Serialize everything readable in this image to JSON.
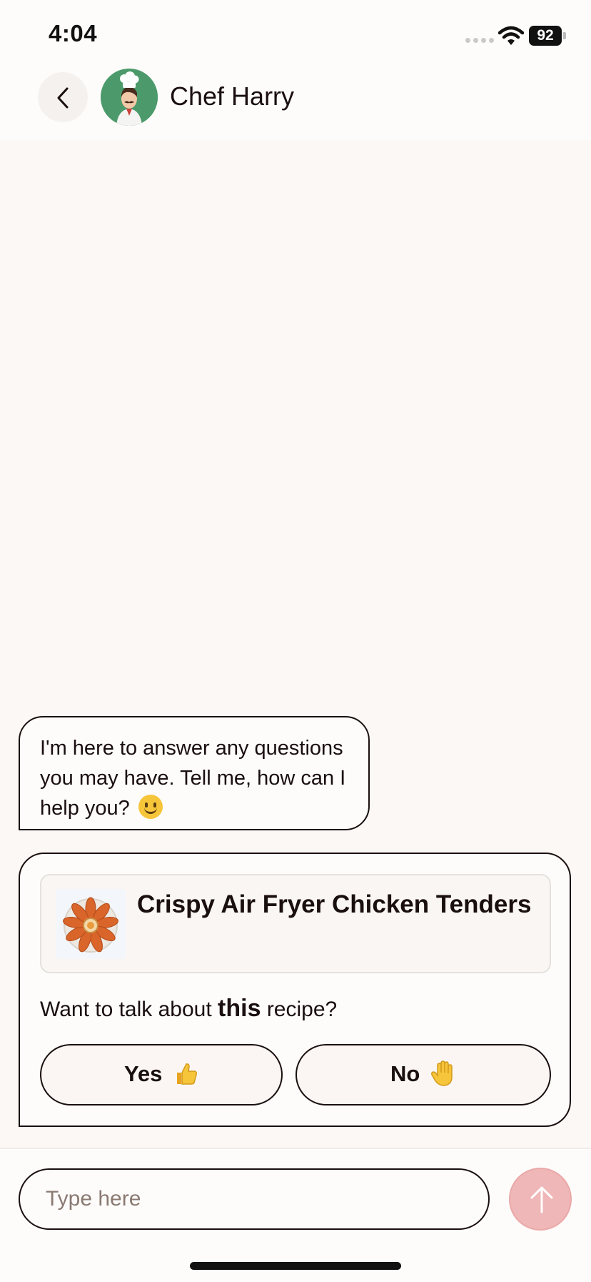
{
  "status_bar": {
    "time": "4:04",
    "battery": "92",
    "icons": [
      "signal-dots-icon",
      "wifi-icon",
      "battery-icon"
    ]
  },
  "header": {
    "back_icon": "chevron-left-icon",
    "avatar": "chef-avatar",
    "title": "Chef Harry"
  },
  "chat": {
    "bot_message": "I'm here to answer any questions you may have. Tell me, how can I help you?",
    "bot_message_emoji": "slightly-smiling-face-emoji",
    "recipe_card": {
      "recipe_title": "Crispy Air Fryer Chicken Tenders",
      "question_prefix": "Want to talk about ",
      "question_emphasis": "this",
      "question_suffix": " recipe?",
      "yes_label": "Yes",
      "yes_emoji": "thumbs-up-emoji",
      "no_label": "No",
      "no_emoji": "raised-hand-emoji"
    }
  },
  "composer": {
    "placeholder": "Type here",
    "value": "",
    "send_icon": "arrow-up-icon"
  },
  "colors": {
    "background": "#FBF8F6",
    "ink": "#1a0f0f",
    "avatar_bg": "#4C9A6B",
    "send_button": "#EFB7B7"
  }
}
